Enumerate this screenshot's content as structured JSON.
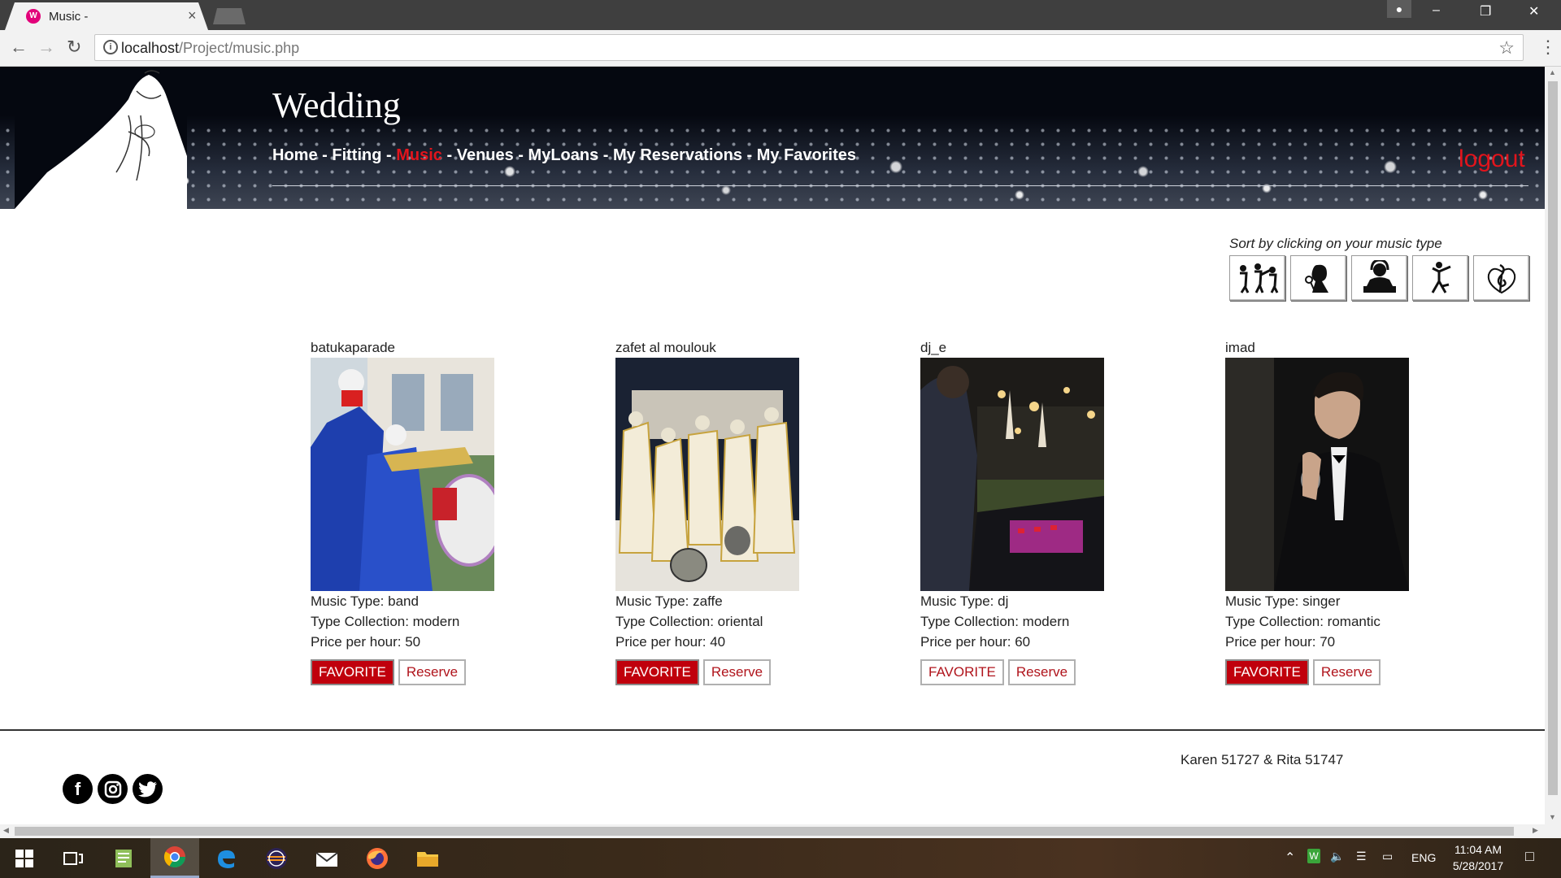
{
  "browser": {
    "tab_title": "Music -",
    "tab_favicon": "W",
    "tab_close": "×",
    "url_host": "localhost",
    "url_path": "/Project/music.php",
    "window_controls": [
      "–",
      "❐",
      "✕"
    ],
    "profile_icon": "person-icon"
  },
  "site": {
    "title": "Wedding",
    "nav": [
      {
        "label": "Home",
        "active": false
      },
      {
        "label": "Fitting",
        "active": false
      },
      {
        "label": "Music",
        "active": true
      },
      {
        "label": "Venues",
        "active": false
      },
      {
        "label": "MyLoans",
        "active": false
      },
      {
        "label": "My Reservations",
        "active": false
      },
      {
        "label": "My Favorites",
        "active": false
      }
    ],
    "nav_separator": " - ",
    "logout": "logout",
    "accent_color": "#e2141c"
  },
  "sort": {
    "label": "Sort by clicking on your music type",
    "types": [
      "band-icon",
      "singer-icon",
      "dj-icon",
      "dancer-icon",
      "music-note-icon"
    ]
  },
  "music": [
    {
      "name": "batukaparade",
      "type_label": "Music Type: band",
      "collection_label": "Type Collection: modern",
      "price_label": "Price per hour: 50",
      "favorite_label": "FAVORITE",
      "favorited": true,
      "reserve_label": "Reserve"
    },
    {
      "name": "zafet al moulouk",
      "type_label": "Music Type: zaffe",
      "collection_label": "Type Collection: oriental",
      "price_label": "Price per hour: 40",
      "favorite_label": "FAVORITE",
      "favorited": true,
      "reserve_label": "Reserve"
    },
    {
      "name": "dj_e",
      "type_label": "Music Type: dj",
      "collection_label": "Type Collection: modern",
      "price_label": "Price per hour: 60",
      "favorite_label": "FAVORITE",
      "favorited": false,
      "reserve_label": "Reserve"
    },
    {
      "name": "imad",
      "type_label": "Music Type: singer",
      "collection_label": "Type Collection: romantic",
      "price_label": "Price per hour: 70",
      "favorite_label": "FAVORITE",
      "favorited": true,
      "reserve_label": "Reserve"
    }
  ],
  "footer": {
    "credit": "Karen 51727 & Rita 51747",
    "social": [
      "facebook-icon",
      "instagram-icon",
      "twitter-icon"
    ]
  },
  "taskbar": {
    "apps": [
      "windows-start-icon",
      "task-view-icon",
      "notepad-icon",
      "chrome-icon",
      "edge-icon",
      "eclipse-icon",
      "mail-icon",
      "firefox-icon",
      "file-explorer-icon"
    ],
    "language": "ENG",
    "time": "11:04 AM",
    "date": "5/28/2017"
  }
}
